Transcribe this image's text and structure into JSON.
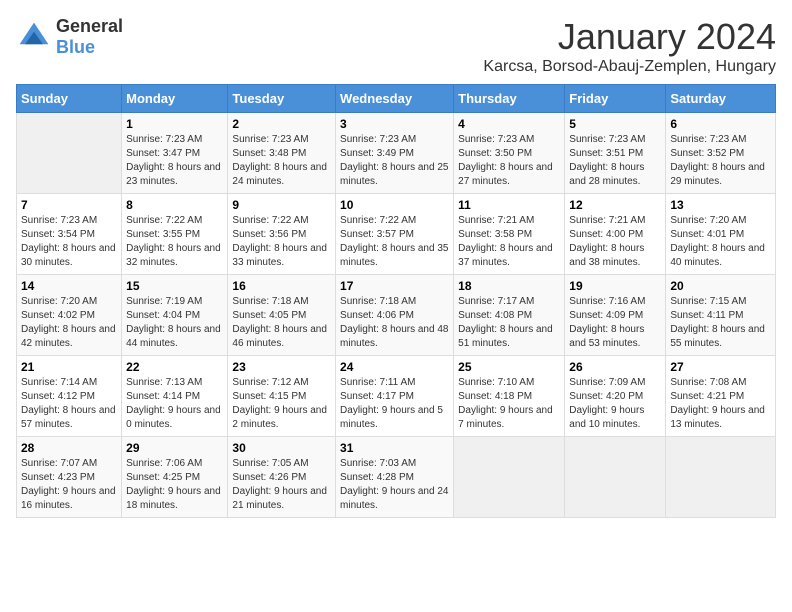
{
  "header": {
    "logo": {
      "general": "General",
      "blue": "Blue"
    },
    "title": "January 2024",
    "subtitle": "Karcsa, Borsod-Abauj-Zemplen, Hungary"
  },
  "weekdays": [
    "Sunday",
    "Monday",
    "Tuesday",
    "Wednesday",
    "Thursday",
    "Friday",
    "Saturday"
  ],
  "weeks": [
    [
      {
        "day": "",
        "sunrise": "",
        "sunset": "",
        "daylight": ""
      },
      {
        "day": "1",
        "sunrise": "Sunrise: 7:23 AM",
        "sunset": "Sunset: 3:47 PM",
        "daylight": "Daylight: 8 hours and 23 minutes."
      },
      {
        "day": "2",
        "sunrise": "Sunrise: 7:23 AM",
        "sunset": "Sunset: 3:48 PM",
        "daylight": "Daylight: 8 hours and 24 minutes."
      },
      {
        "day": "3",
        "sunrise": "Sunrise: 7:23 AM",
        "sunset": "Sunset: 3:49 PM",
        "daylight": "Daylight: 8 hours and 25 minutes."
      },
      {
        "day": "4",
        "sunrise": "Sunrise: 7:23 AM",
        "sunset": "Sunset: 3:50 PM",
        "daylight": "Daylight: 8 hours and 27 minutes."
      },
      {
        "day": "5",
        "sunrise": "Sunrise: 7:23 AM",
        "sunset": "Sunset: 3:51 PM",
        "daylight": "Daylight: 8 hours and 28 minutes."
      },
      {
        "day": "6",
        "sunrise": "Sunrise: 7:23 AM",
        "sunset": "Sunset: 3:52 PM",
        "daylight": "Daylight: 8 hours and 29 minutes."
      }
    ],
    [
      {
        "day": "7",
        "sunrise": "Sunrise: 7:23 AM",
        "sunset": "Sunset: 3:54 PM",
        "daylight": "Daylight: 8 hours and 30 minutes."
      },
      {
        "day": "8",
        "sunrise": "Sunrise: 7:22 AM",
        "sunset": "Sunset: 3:55 PM",
        "daylight": "Daylight: 8 hours and 32 minutes."
      },
      {
        "day": "9",
        "sunrise": "Sunrise: 7:22 AM",
        "sunset": "Sunset: 3:56 PM",
        "daylight": "Daylight: 8 hours and 33 minutes."
      },
      {
        "day": "10",
        "sunrise": "Sunrise: 7:22 AM",
        "sunset": "Sunset: 3:57 PM",
        "daylight": "Daylight: 8 hours and 35 minutes."
      },
      {
        "day": "11",
        "sunrise": "Sunrise: 7:21 AM",
        "sunset": "Sunset: 3:58 PM",
        "daylight": "Daylight: 8 hours and 37 minutes."
      },
      {
        "day": "12",
        "sunrise": "Sunrise: 7:21 AM",
        "sunset": "Sunset: 4:00 PM",
        "daylight": "Daylight: 8 hours and 38 minutes."
      },
      {
        "day": "13",
        "sunrise": "Sunrise: 7:20 AM",
        "sunset": "Sunset: 4:01 PM",
        "daylight": "Daylight: 8 hours and 40 minutes."
      }
    ],
    [
      {
        "day": "14",
        "sunrise": "Sunrise: 7:20 AM",
        "sunset": "Sunset: 4:02 PM",
        "daylight": "Daylight: 8 hours and 42 minutes."
      },
      {
        "day": "15",
        "sunrise": "Sunrise: 7:19 AM",
        "sunset": "Sunset: 4:04 PM",
        "daylight": "Daylight: 8 hours and 44 minutes."
      },
      {
        "day": "16",
        "sunrise": "Sunrise: 7:18 AM",
        "sunset": "Sunset: 4:05 PM",
        "daylight": "Daylight: 8 hours and 46 minutes."
      },
      {
        "day": "17",
        "sunrise": "Sunrise: 7:18 AM",
        "sunset": "Sunset: 4:06 PM",
        "daylight": "Daylight: 8 hours and 48 minutes."
      },
      {
        "day": "18",
        "sunrise": "Sunrise: 7:17 AM",
        "sunset": "Sunset: 4:08 PM",
        "daylight": "Daylight: 8 hours and 51 minutes."
      },
      {
        "day": "19",
        "sunrise": "Sunrise: 7:16 AM",
        "sunset": "Sunset: 4:09 PM",
        "daylight": "Daylight: 8 hours and 53 minutes."
      },
      {
        "day": "20",
        "sunrise": "Sunrise: 7:15 AM",
        "sunset": "Sunset: 4:11 PM",
        "daylight": "Daylight: 8 hours and 55 minutes."
      }
    ],
    [
      {
        "day": "21",
        "sunrise": "Sunrise: 7:14 AM",
        "sunset": "Sunset: 4:12 PM",
        "daylight": "Daylight: 8 hours and 57 minutes."
      },
      {
        "day": "22",
        "sunrise": "Sunrise: 7:13 AM",
        "sunset": "Sunset: 4:14 PM",
        "daylight": "Daylight: 9 hours and 0 minutes."
      },
      {
        "day": "23",
        "sunrise": "Sunrise: 7:12 AM",
        "sunset": "Sunset: 4:15 PM",
        "daylight": "Daylight: 9 hours and 2 minutes."
      },
      {
        "day": "24",
        "sunrise": "Sunrise: 7:11 AM",
        "sunset": "Sunset: 4:17 PM",
        "daylight": "Daylight: 9 hours and 5 minutes."
      },
      {
        "day": "25",
        "sunrise": "Sunrise: 7:10 AM",
        "sunset": "Sunset: 4:18 PM",
        "daylight": "Daylight: 9 hours and 7 minutes."
      },
      {
        "day": "26",
        "sunrise": "Sunrise: 7:09 AM",
        "sunset": "Sunset: 4:20 PM",
        "daylight": "Daylight: 9 hours and 10 minutes."
      },
      {
        "day": "27",
        "sunrise": "Sunrise: 7:08 AM",
        "sunset": "Sunset: 4:21 PM",
        "daylight": "Daylight: 9 hours and 13 minutes."
      }
    ],
    [
      {
        "day": "28",
        "sunrise": "Sunrise: 7:07 AM",
        "sunset": "Sunset: 4:23 PM",
        "daylight": "Daylight: 9 hours and 16 minutes."
      },
      {
        "day": "29",
        "sunrise": "Sunrise: 7:06 AM",
        "sunset": "Sunset: 4:25 PM",
        "daylight": "Daylight: 9 hours and 18 minutes."
      },
      {
        "day": "30",
        "sunrise": "Sunrise: 7:05 AM",
        "sunset": "Sunset: 4:26 PM",
        "daylight": "Daylight: 9 hours and 21 minutes."
      },
      {
        "day": "31",
        "sunrise": "Sunrise: 7:03 AM",
        "sunset": "Sunset: 4:28 PM",
        "daylight": "Daylight: 9 hours and 24 minutes."
      },
      {
        "day": "",
        "sunrise": "",
        "sunset": "",
        "daylight": ""
      },
      {
        "day": "",
        "sunrise": "",
        "sunset": "",
        "daylight": ""
      },
      {
        "day": "",
        "sunrise": "",
        "sunset": "",
        "daylight": ""
      }
    ]
  ]
}
